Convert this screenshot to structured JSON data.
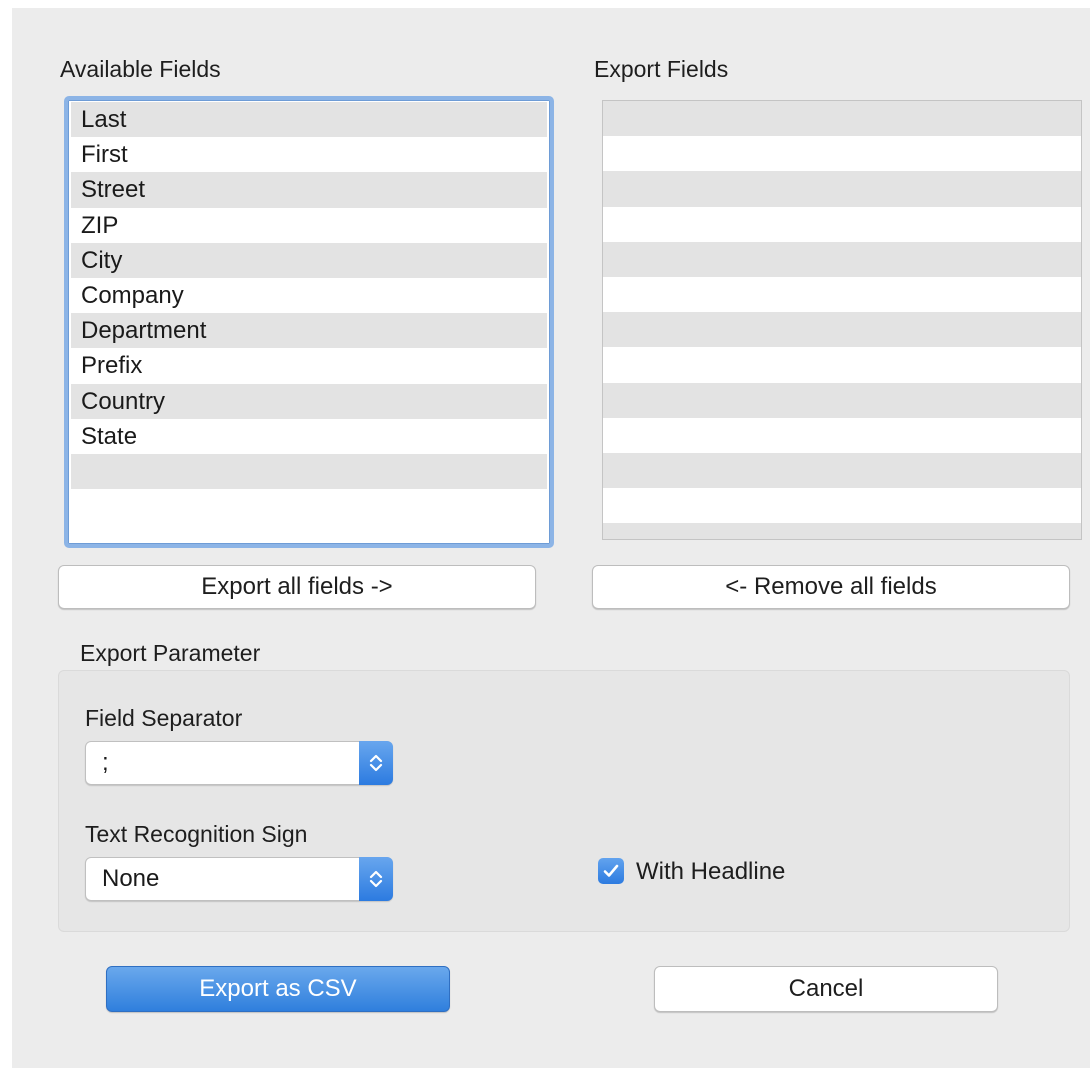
{
  "available": {
    "label": "Available Fields",
    "items": [
      "Last",
      "First",
      "Street",
      "ZIP",
      "City",
      "Company",
      "Department",
      "Prefix",
      "Country",
      "State",
      "",
      ""
    ],
    "row_count": 12
  },
  "export": {
    "label": "Export Fields",
    "items": [
      "",
      "",
      "",
      "",
      "",
      "",
      "",
      "",
      "",
      "",
      "",
      "",
      ""
    ]
  },
  "buttons": {
    "export_all": "Export all fields ->",
    "remove_all": "<- Remove all fields",
    "export_csv": "Export as CSV",
    "cancel": "Cancel"
  },
  "parameters": {
    "group_label": "Export Parameter",
    "separator_label": "Field Separator",
    "separator_value": ";",
    "recognition_label": "Text Recognition Sign",
    "recognition_value": "None",
    "headline_label": "With Headline",
    "headline_checked": true
  },
  "colors": {
    "accent": "#2f7fdd",
    "focus_ring": "#8cb4e6",
    "alt_row": "#e3e3e3"
  },
  "icons": {
    "stepper": "up-down-chevron-icon",
    "check": "checkmark-icon"
  }
}
